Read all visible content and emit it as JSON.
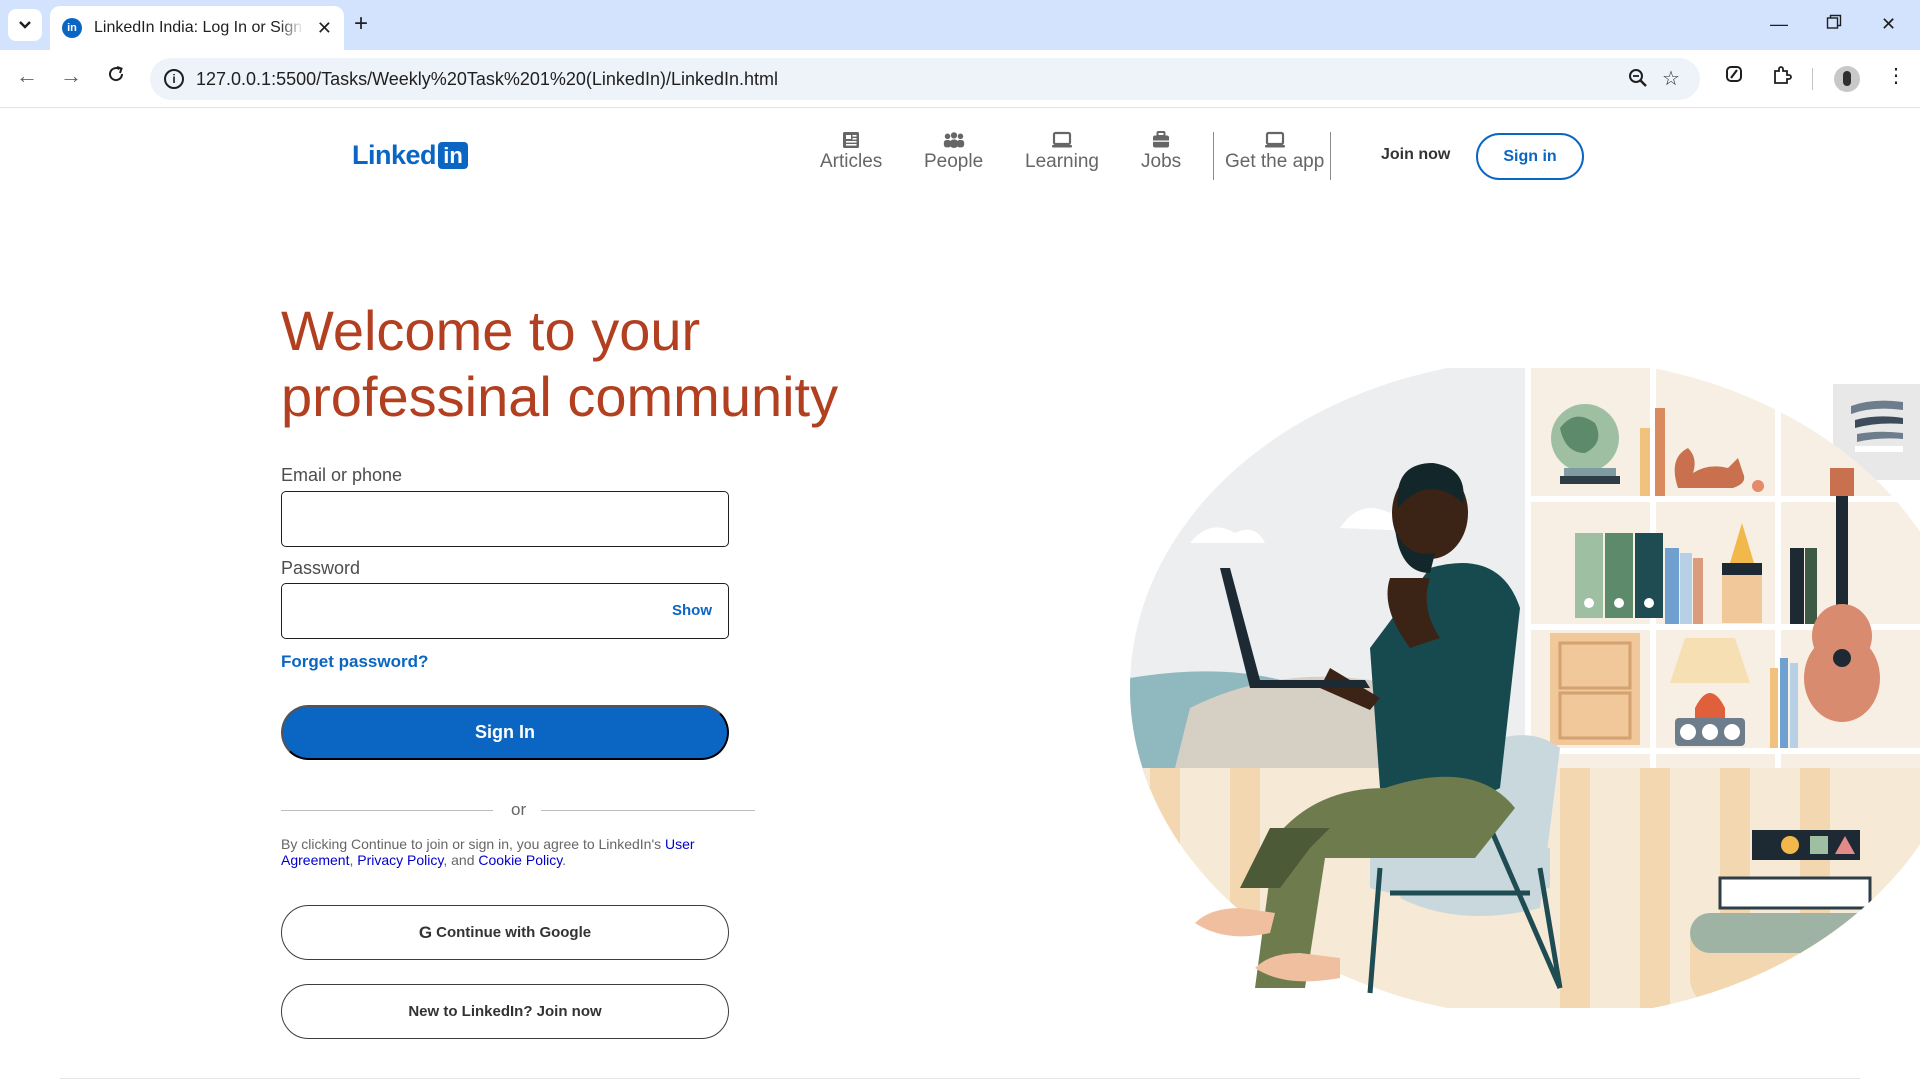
{
  "browser": {
    "tab_title": "LinkedIn India: Log In or Sign Up",
    "favicon_text": "in",
    "url": "127.0.0.1:5500/Tasks/Weekly%20Task%201%20(LinkedIn)/LinkedIn.html",
    "icons": [
      "tab-list-chevron-icon",
      "close-icon",
      "new-tab-icon",
      "minimize-icon",
      "restore-icon",
      "window-close-icon",
      "back-icon",
      "forward-icon",
      "reload-icon",
      "site-info-icon",
      "zoom-icon",
      "bookmark-star-icon",
      "extension-icon",
      "puzzle-icon",
      "avatar",
      "kebab-menu-icon"
    ]
  },
  "header": {
    "logo_text": "Linked",
    "logo_box_text": "in",
    "nav": [
      {
        "label": "Articles",
        "icon": "articles-icon"
      },
      {
        "label": "People",
        "icon": "people-icon"
      },
      {
        "label": "Learning",
        "icon": "learning-icon"
      },
      {
        "label": "Jobs",
        "icon": "jobs-icon"
      },
      {
        "label": "Get the app",
        "icon": "get-app-icon"
      }
    ],
    "join_now": "Join now",
    "sign_in": "Sign in"
  },
  "hero": {
    "line1": "Welcome to your",
    "line2": "professinal community"
  },
  "form": {
    "email_label": "Email or phone",
    "email_value": "",
    "password_label": "Password",
    "password_value": "",
    "show_label": "Show",
    "forgot": "Forget password?",
    "sign_in_button": "Sign In",
    "or_text": "or",
    "legal_prefix": "By clicking Continue to join or sign in, you agree to LinkedIn's ",
    "user_agreement": "User Agreement",
    "comma": ", ",
    "privacy_policy": "Privacy Policy",
    "and_text": ", and ",
    "cookie_policy": "Cookie Policy",
    "period": ".",
    "google_icon": "G",
    "google_button": "Continue with Google",
    "join_button": "New to LinkedIn? Join now"
  },
  "colors": {
    "brand_blue": "#0a66c2",
    "hero_text": "#b24020",
    "chrome_tabbar": "#d3e3fd"
  }
}
